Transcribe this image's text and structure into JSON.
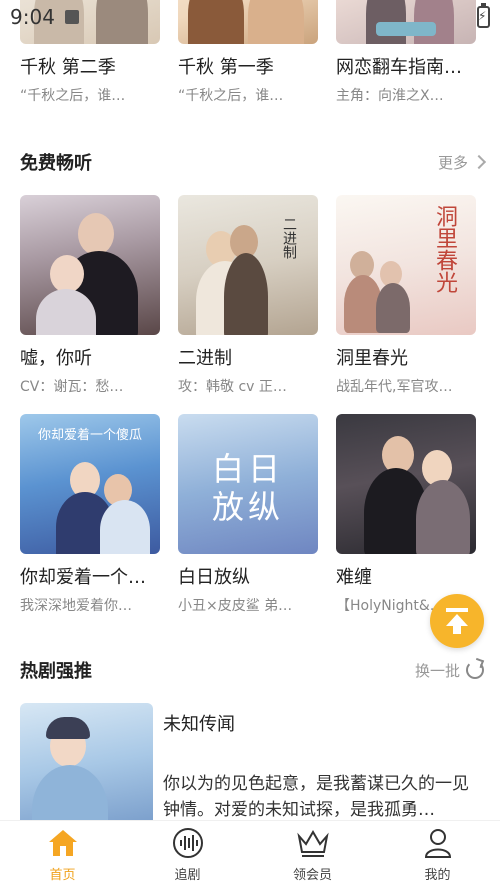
{
  "status_bar": {
    "time": "9:04"
  },
  "top_row": [
    {
      "title": "千秋 第二季",
      "subtitle": "“千秋之后，谁…"
    },
    {
      "title": "千秋 第一季",
      "subtitle": "“千秋之后，谁…"
    },
    {
      "title": "网恋翻车指南…",
      "subtitle": "主角：向淮之X…"
    }
  ],
  "free_section": {
    "title": "免费畅听",
    "more_label": "更多",
    "items": [
      {
        "title": "嘘，你听",
        "subtitle": "CV：谢瓦：愁…",
        "cover_text": ""
      },
      {
        "title": "二进制",
        "subtitle": "攻：韩敬 cv 正…",
        "cover_text": "二进制"
      },
      {
        "title": "洞里春光",
        "subtitle": "战乱年代,军官攻…",
        "cover_text": "洞里春光"
      },
      {
        "title": "你却爱着一个…",
        "subtitle": "我深深地爱着你…",
        "cover_text": "你却爱着一个傻瓜"
      },
      {
        "title": "白日放纵",
        "subtitle": "小丑×皮皮鲨 弟…",
        "cover_text": "白日放纵"
      },
      {
        "title": "难缠",
        "subtitle": "【HolyNight&…",
        "cover_text": ""
      }
    ]
  },
  "hot_section": {
    "title": "热剧强推",
    "refresh_label": "换一批",
    "feature": {
      "title": "未知传闻",
      "description": "你以为的见色起意，是我蓄谋已久的一见钟情。对爱的未知试探，是我孤勇…"
    }
  },
  "tabbar": {
    "tabs": [
      {
        "label": "首页",
        "icon": "home-icon",
        "active": true
      },
      {
        "label": "追剧",
        "icon": "audio-wave-icon",
        "active": false
      },
      {
        "label": "领会员",
        "icon": "crown-icon",
        "active": false
      },
      {
        "label": "我的",
        "icon": "user-icon",
        "active": false
      }
    ]
  },
  "colors": {
    "accent": "#f0a21b",
    "fab": "#f7b52b"
  }
}
